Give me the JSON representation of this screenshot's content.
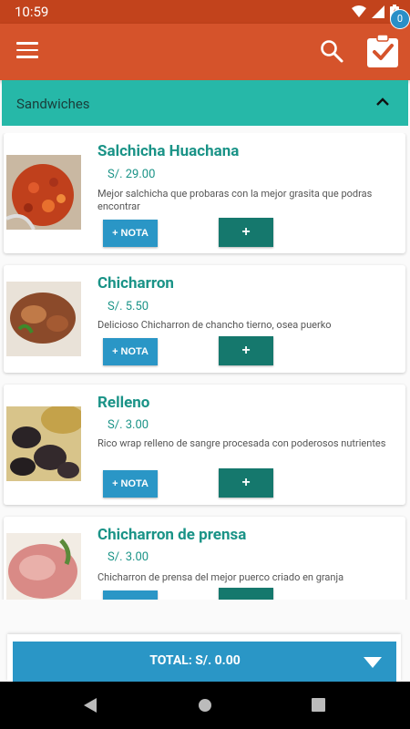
{
  "status_bar": {
    "time": "10:59"
  },
  "toolbar": {
    "cart_count": "0"
  },
  "section": {
    "title": "Sandwiches"
  },
  "products": [
    {
      "name": "Salchicha Huachana",
      "price": "S/. 29.00",
      "description": "Mejor salchicha que probaras con la mejor grasita que podras encontrar",
      "note_label": "+ NOTA",
      "add_label": "+"
    },
    {
      "name": "Chicharron",
      "price": "S/. 5.50",
      "description": "Delicioso Chicharron de chancho tierno, osea puerko",
      "note_label": "+ NOTA",
      "add_label": "+"
    },
    {
      "name": "Relleno",
      "price": "S/. 3.00",
      "description": "Rico wrap relleno de sangre procesada con poderosos nutrientes",
      "note_label": "+ NOTA",
      "add_label": "+"
    },
    {
      "name": "Chicharron de prensa",
      "price": "S/. 3.00",
      "description": "Chicharron de prensa del mejor puerco criado en granja",
      "note_label": "",
      "add_label": ""
    }
  ],
  "footer": {
    "total_label": "TOTAL: S/. 0.00"
  },
  "colors": {
    "toolbar": "#d5532b",
    "status_bar": "#c2431c",
    "section": "#26b8a8",
    "accent_teal": "#1a9387",
    "note_button": "#2a96c6",
    "add_button": "#15786d"
  }
}
